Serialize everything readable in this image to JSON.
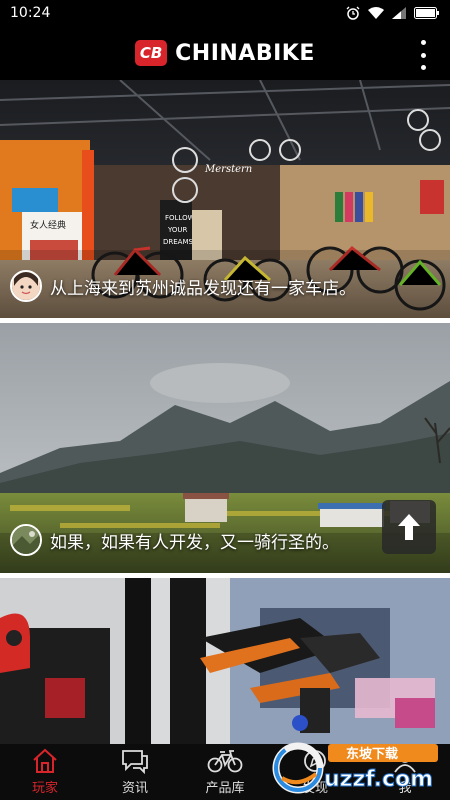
{
  "status_bar": {
    "time": "10:24"
  },
  "header": {
    "brand_logo": "CB",
    "brand_name": "CHINABIKE"
  },
  "feed": {
    "posts": [
      {
        "caption": "从上海来到苏州诚品发现还有一家车店。"
      },
      {
        "caption": "如果，如果有人开发，又一骑行圣的。"
      },
      {
        "caption": ""
      }
    ]
  },
  "scene_text": {
    "store_sign_1": "FOLLOW",
    "store_sign_2": "YOUR",
    "store_sign_3": "DREAMS",
    "brand_sign": "Merstern",
    "poster": "女人经典"
  },
  "bottom_nav": {
    "items": [
      {
        "label": "玩家",
        "icon": "home-icon",
        "active": true
      },
      {
        "label": "资讯",
        "icon": "chat-icon",
        "active": false
      },
      {
        "label": "产品库",
        "icon": "bicycle-icon",
        "active": false
      },
      {
        "label": "发现",
        "icon": "compass-icon",
        "active": false
      },
      {
        "label": "我",
        "icon": "person-icon",
        "active": false
      }
    ]
  },
  "watermark": {
    "text": "东坡下载",
    "site": "uzzf.com"
  },
  "colors": {
    "accent": "#d8252b",
    "background": "#000000"
  }
}
